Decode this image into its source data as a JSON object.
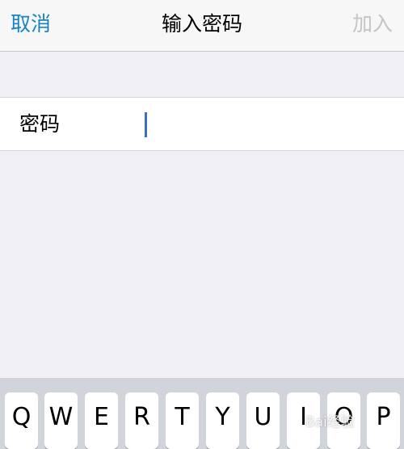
{
  "navbar": {
    "cancel_label": "取消",
    "title": "输入密码",
    "join_label": "加入"
  },
  "form": {
    "password_label": "密码",
    "password_value": "",
    "password_placeholder": ""
  },
  "keyboard": {
    "row1": [
      "Q",
      "W",
      "E",
      "R",
      "T",
      "Y",
      "U",
      "I",
      "O",
      "P"
    ]
  },
  "watermark": "Bai经验",
  "colors": {
    "accent": "#1a82c4",
    "disabled": "#c4c4c9",
    "background": "#efeff4",
    "keyboard_bg": "#d1d4da",
    "caret": "#3f6fb8"
  }
}
